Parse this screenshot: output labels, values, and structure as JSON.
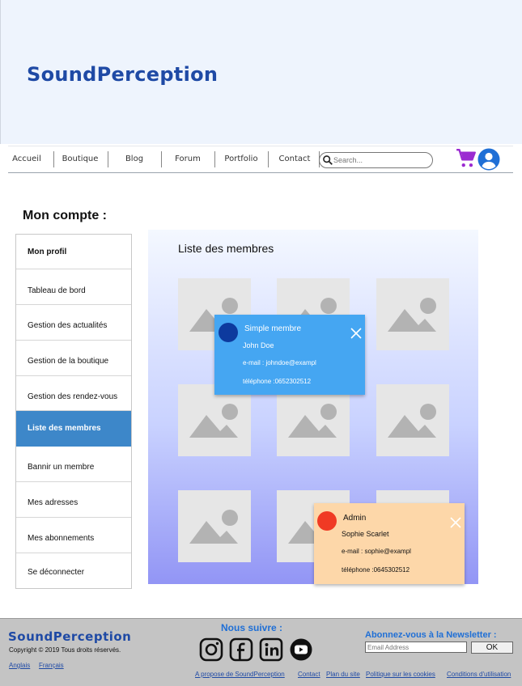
{
  "header": {
    "brand": "SoundPerception"
  },
  "nav": {
    "items": [
      "Accueil",
      "Boutique",
      "Blog",
      "Forum",
      "Portfolio",
      "Contact"
    ],
    "search_placeholder": "Search..."
  },
  "account": {
    "title": "Mon compte :",
    "menu": [
      "Mon profil",
      "Tableau de bord",
      "Gestion des actualités",
      "Gestion de la boutique",
      "Gestion des rendez-vous",
      "Liste des membres",
      "Bannir un membre",
      "Mes adresses",
      "Mes abonnements",
      "Se déconnecter"
    ],
    "active_index": 5
  },
  "members": {
    "title": "Liste des membres",
    "popups": [
      {
        "role": "Simple membre",
        "name": "John Doe",
        "email": "e-mail : johndoe@exampl",
        "phone": "téléphone :0652302512",
        "avatar_color": "#0d3a9e",
        "bg_color": "#45a6f2"
      },
      {
        "role": "Admin",
        "name": "Sophie Scarlet",
        "email": "e-mail : sophie@exampl",
        "phone": "téléphone :0645302512",
        "avatar_color": "#f03a24",
        "bg_color": "#fdd7a9"
      }
    ]
  },
  "footer": {
    "brand": "SoundPerception",
    "copyright": "Copyright © 2019 Tous droits réservés.",
    "languages": [
      "Anglais",
      "Français"
    ],
    "follow_title": "Nous suivre :",
    "social_icons": [
      "instagram-icon",
      "facebook-icon",
      "linkedin-icon",
      "youtube-icon"
    ],
    "newsletter_title": "Abonnez-vous à la Newsletter :",
    "email_placeholder": "Email Address",
    "ok_label": "OK",
    "links": [
      "A propose de SoundPerception",
      "Contact",
      "Plan du site",
      "Politique sur les cookies",
      "Conditions d'utilisation"
    ]
  },
  "colors": {
    "brand": "#1f4aa5",
    "cart": "#9b2bd1",
    "user": "#1f6fd6",
    "active_menu": "#3d87c9"
  }
}
